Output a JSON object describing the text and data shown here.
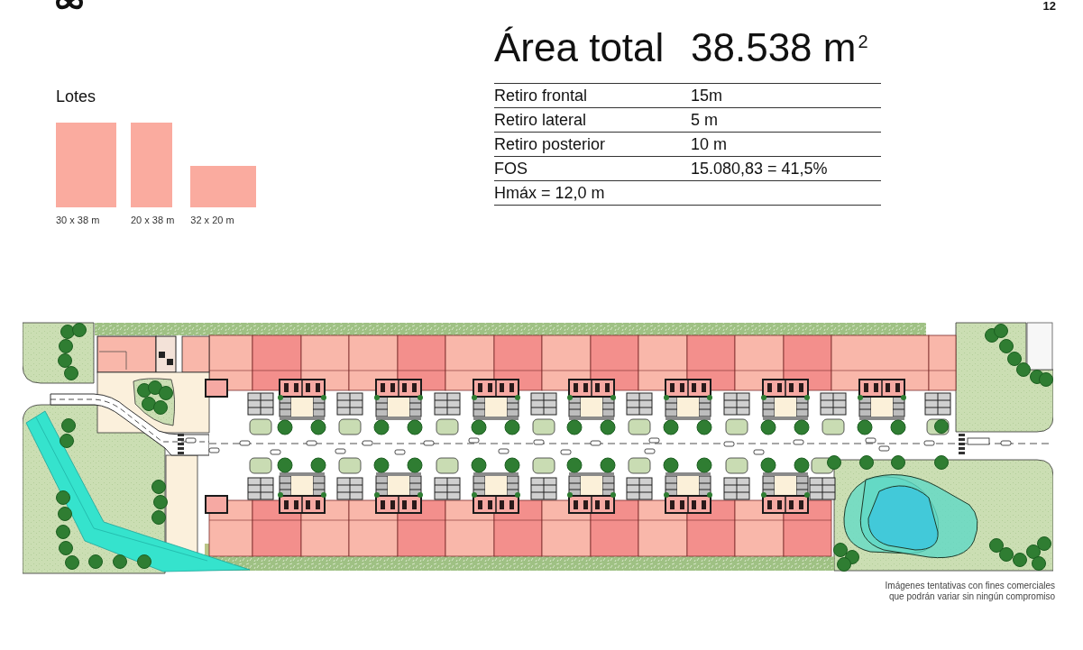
{
  "header": {
    "page_number": "12"
  },
  "area": {
    "label": "Área total",
    "value": "38.538 m$^{2}$"
  },
  "parameters": [
    {
      "label": "Retiro frontal",
      "value": "15m"
    },
    {
      "label": "Retiro lateral",
      "value": "5 m"
    },
    {
      "label": "Retiro posterior",
      "value": "10 m"
    },
    {
      "label": "FOS",
      "value": "15.080,83 = 41,5%"
    },
    {
      "label": "Hmáx = 12,0 m"
    }
  ],
  "lots": {
    "title": "Lotes",
    "items": [
      {
        "label": "30 x 38 m"
      },
      {
        "label": "20 x 38 m"
      },
      {
        "label": "32 x 20 m"
      }
    ]
  },
  "disclaimer": {
    "lines": [
      "Imágenes tentativas con fines comerciales",
      "que podrán variar sin ningún compromiso"
    ]
  }
}
